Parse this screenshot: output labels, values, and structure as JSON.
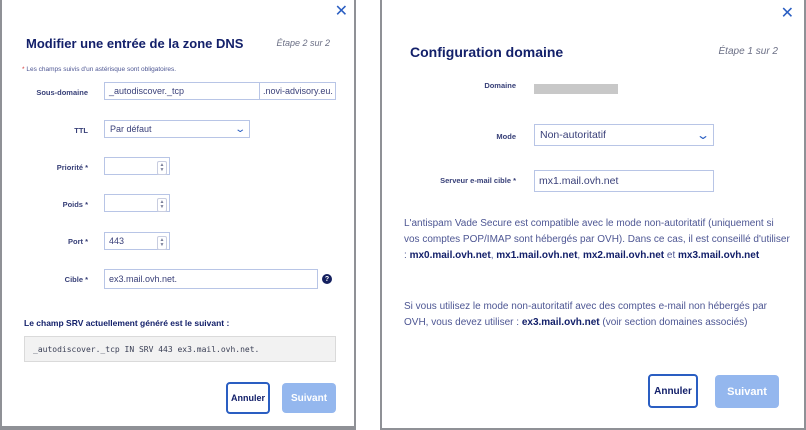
{
  "left_modal": {
    "title": "Modifier une entrée de la zone DNS",
    "step": "Étape 2 sur 2",
    "required_note": "Les champs suivis d'un astérisque sont obligatoires.",
    "required_star": "*",
    "fields": {
      "subdomain": {
        "label": "Sous-domaine",
        "value": "_autodiscover._tcp",
        "suffix": ".novi-advisory.eu."
      },
      "ttl": {
        "label": "TTL",
        "value": "Par défaut"
      },
      "priority": {
        "label": "Priorité  *",
        "value": ""
      },
      "weight": {
        "label": "Poids  *",
        "value": ""
      },
      "port": {
        "label": "Port  *",
        "value": "443"
      },
      "target": {
        "label": "Cible  *",
        "value": "ex3.mail.ovh.net."
      }
    },
    "srv_label": "Le champ SRV actuellement généré est le suivant :",
    "srv_value": "_autodiscover._tcp IN SRV 443 ex3.mail.ovh.net.",
    "cancel_label": "Annuler",
    "next_label": "Suivant"
  },
  "right_modal": {
    "title": "Configuration domaine",
    "step": "Étape 1 sur 2",
    "domain_label": "Domaine",
    "mode_label": "Mode",
    "mode_value": "Non-autoritatif",
    "server_label": "Serveur e-mail cible  *",
    "server_value": "mx1.mail.ovh.net",
    "para1": {
      "text1": "L'antispam Vade Secure est compatible avec le mode non-autoritatif (uniquement si vos comptes POP/IMAP sont hébergés par OVH). Dans ce cas, il est conseillé d'utiliser : ",
      "mx0": "mx0.mail.ovh.net",
      "sep1": ", ",
      "mx1": "mx1.mail.ovh.net",
      "sep2": ",",
      "mx2": "mx2.mail.ovh.net",
      "and": " et ",
      "mx3": "mx3.mail.ovh.net"
    },
    "para2": {
      "text1": "Si vous utilisez le mode non-autoritatif avec des comptes e-mail non hébergés par OVH, vous devez utiliser : ",
      "ex3": "ex3.mail.ovh.net",
      "text2": " (voir section domaines associés)"
    },
    "cancel_label": "Annuler",
    "next_label": "Suivant"
  },
  "icons": {
    "close": "close-icon",
    "chevron": "chevron-down-icon",
    "help": "help-icon",
    "stepper": "stepper-arrows-icon"
  },
  "colors": {
    "accent": "#2a5ec2",
    "title": "#13206a",
    "text": "#4d5693",
    "disabled_button": "#94b7ee",
    "backdrop": "#8f9196"
  }
}
